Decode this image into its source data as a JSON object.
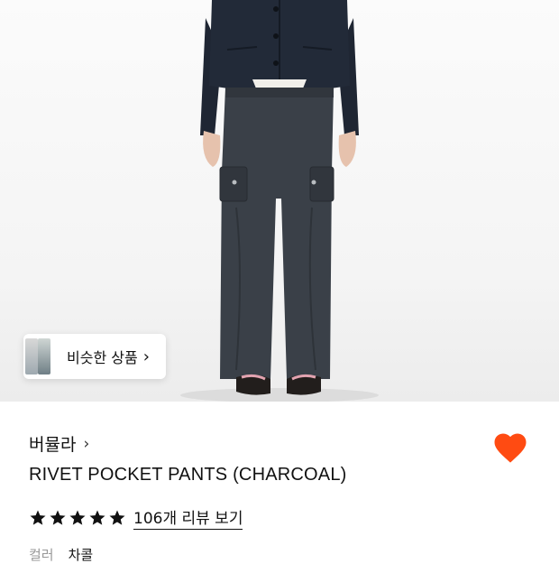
{
  "similar_products": {
    "label": "비슷한 상품",
    "chevron_icon": "chevron-right-icon"
  },
  "brand": {
    "name": "버뮬라",
    "chevron_icon": "chevron-right-icon"
  },
  "product": {
    "title": "RIVET POCKET PANTS (CHARCOAL)"
  },
  "wishlist": {
    "icon": "heart-icon",
    "active": true,
    "color": "#ff4b12"
  },
  "rating": {
    "stars": 5,
    "max": 5,
    "review_link": "106개 리뷰 보기"
  },
  "options": {
    "color_label": "컬러",
    "color_value": "차콜"
  },
  "colors": {
    "accent": "#ff4b12",
    "text": "#111111",
    "muted": "#999999"
  }
}
